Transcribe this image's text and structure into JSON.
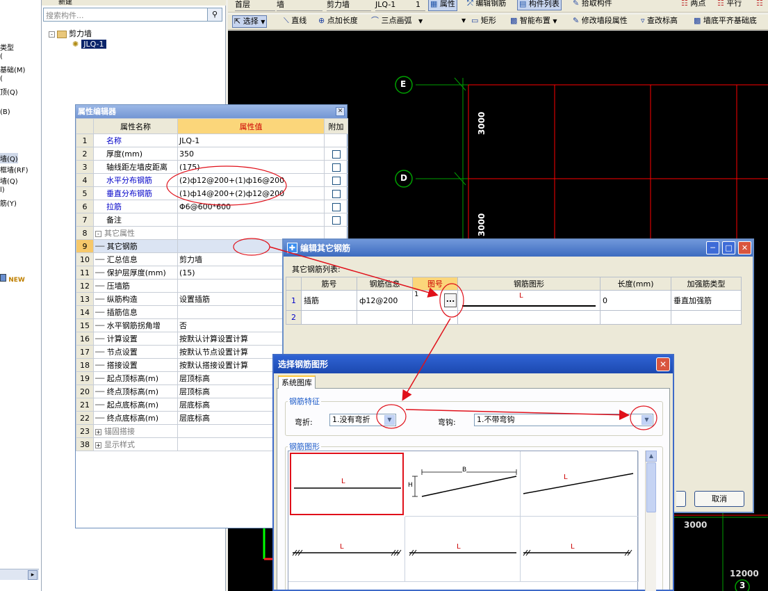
{
  "left_panel": {
    "items": [
      "类型",
      "(",
      "基础(M)",
      "(",
      "顶(Q)",
      "(B)",
      "墙(Q)",
      "框墙(RF)",
      "墙(Q)",
      "l)",
      "筋(Y)"
    ],
    "new_badge": "NEW"
  },
  "tree_panel": {
    "new_label": "新建",
    "search_placeholder": "搜索构件...",
    "tree_root": "剪力墙",
    "tree_child": "JLQ-1"
  },
  "toolbar1": {
    "floor": "首层",
    "type": "墙",
    "subtype": "剪力墙",
    "component": "JLQ-1",
    "count": "1",
    "property_btn": "属性",
    "edit_rebar_btn": "编辑钢筋",
    "component_list_btn": "构件列表",
    "pick_btn": "拾取构件",
    "two_points": "两点",
    "parallel": "平行"
  },
  "toolbar2": {
    "select": "选择",
    "line": "直线",
    "point_length": "点加长度",
    "three_point_arc": "三点画弧",
    "rect": "矩形",
    "smart_layout": "智能布置",
    "modify_segment": "修改墙段属性",
    "check_elevation": "查改标高",
    "align_bottom": "墙底平齐基础底"
  },
  "canvas": {
    "axis_e": "E",
    "axis_d": "D",
    "axis_3": "3",
    "dim_3000_a": "3000",
    "dim_3000_b": "3000",
    "dim_3000_c": "3000",
    "dim_12000": "12000"
  },
  "property_editor": {
    "title": "属性编辑器",
    "headers": [
      "属性名称",
      "属性值",
      "附加"
    ],
    "rows": [
      {
        "no": "1",
        "name": "名称",
        "value": "JLQ-1",
        "color": "blue",
        "check": false
      },
      {
        "no": "2",
        "name": "厚度(mm)",
        "value": "350",
        "color": "black",
        "check": true
      },
      {
        "no": "3",
        "name": "轴线距左墙皮距离",
        "value": "(175)",
        "color": "black",
        "check": true
      },
      {
        "no": "4",
        "name": "水平分布钢筋",
        "value": "(2)ф12@200+(1)ф16@200",
        "color": "blue",
        "check": true
      },
      {
        "no": "5",
        "name": "垂直分布钢筋",
        "value": "(1)ф14@200+(2)ф12@200",
        "color": "blue",
        "check": true
      },
      {
        "no": "6",
        "name": "拉筋",
        "value": "Φ6@600*600",
        "color": "blue",
        "check": true
      },
      {
        "no": "7",
        "name": "备注",
        "value": "",
        "color": "black",
        "check": true
      },
      {
        "no": "8",
        "name": "其它属性",
        "value": "",
        "color": "gray",
        "group": "-"
      },
      {
        "no": "9",
        "name": "其它钢筋",
        "value": "",
        "color": "black",
        "child": true,
        "current": true
      },
      {
        "no": "10",
        "name": "汇总信息",
        "value": "剪力墙",
        "color": "black",
        "child": true
      },
      {
        "no": "11",
        "name": "保护层厚度(mm)",
        "value": "(15)",
        "color": "black",
        "child": true
      },
      {
        "no": "12",
        "name": "压墙筋",
        "value": "",
        "color": "black",
        "child": true
      },
      {
        "no": "13",
        "name": "纵筋构造",
        "value": "设置插筋",
        "color": "black",
        "child": true
      },
      {
        "no": "14",
        "name": "插筋信息",
        "value": "",
        "color": "black",
        "child": true
      },
      {
        "no": "15",
        "name": "水平钢筋拐角增",
        "value": "否",
        "color": "black",
        "child": true
      },
      {
        "no": "16",
        "name": "计算设置",
        "value": "按默认计算设置计算",
        "color": "black",
        "child": true
      },
      {
        "no": "17",
        "name": "节点设置",
        "value": "按默认节点设置计算",
        "color": "black",
        "child": true
      },
      {
        "no": "18",
        "name": "搭接设置",
        "value": "按默认搭接设置计算",
        "color": "black",
        "child": true
      },
      {
        "no": "19",
        "name": "起点顶标高(m)",
        "value": "层顶标高",
        "color": "black",
        "child": true
      },
      {
        "no": "20",
        "name": "终点顶标高(m)",
        "value": "层顶标高",
        "color": "black",
        "child": true
      },
      {
        "no": "21",
        "name": "起点底标高(m)",
        "value": "层底标高",
        "color": "black",
        "child": true
      },
      {
        "no": "22",
        "name": "终点底标高(m)",
        "value": "层底标高",
        "color": "black",
        "child": true
      },
      {
        "no": "23",
        "name": "锚固搭接",
        "value": "",
        "color": "gray",
        "group": "+"
      },
      {
        "no": "38",
        "name": "显示样式",
        "value": "",
        "color": "gray",
        "group": "+"
      }
    ]
  },
  "edit_rebar_window": {
    "title": "编辑其它钢筋",
    "list_label": "其它钢筋列表:",
    "headers": [
      "筋号",
      "钢筋信息",
      "图号",
      "钢筋图形",
      "长度(mm)",
      "加强筋类型"
    ],
    "rows": [
      {
        "no": "1",
        "name": "插筋",
        "info": "ф12@200",
        "shape_no": "1",
        "shape_label": "L",
        "length": "0",
        "type": "垂直加强筋"
      },
      {
        "no": "2",
        "name": "",
        "info": "",
        "shape_no": "",
        "shape_label": "",
        "length": "",
        "type": ""
      }
    ],
    "dots": "...",
    "cancel": "取消"
  },
  "select_shape_dialog": {
    "title": "选择钢筋图形",
    "tab": "系统图库",
    "feature_group": "钢筋特征",
    "bend_label": "弯折:",
    "bend_value": "1.没有弯折",
    "hook_label": "弯钩:",
    "hook_value": "1.不带弯钩",
    "shape_group": "钢筋图形",
    "shapes": [
      {
        "label": "L",
        "selected": true
      },
      {
        "label": "B",
        "label2": "H"
      },
      {
        "label": "L"
      },
      {
        "label": "L"
      },
      {
        "label": "L"
      },
      {
        "label": "L"
      }
    ]
  },
  "colors": {
    "canvas_bg": "#000000",
    "grid_green": "#00a000",
    "wall_red": "#ff0000",
    "highlight_red": "#e0101a"
  }
}
